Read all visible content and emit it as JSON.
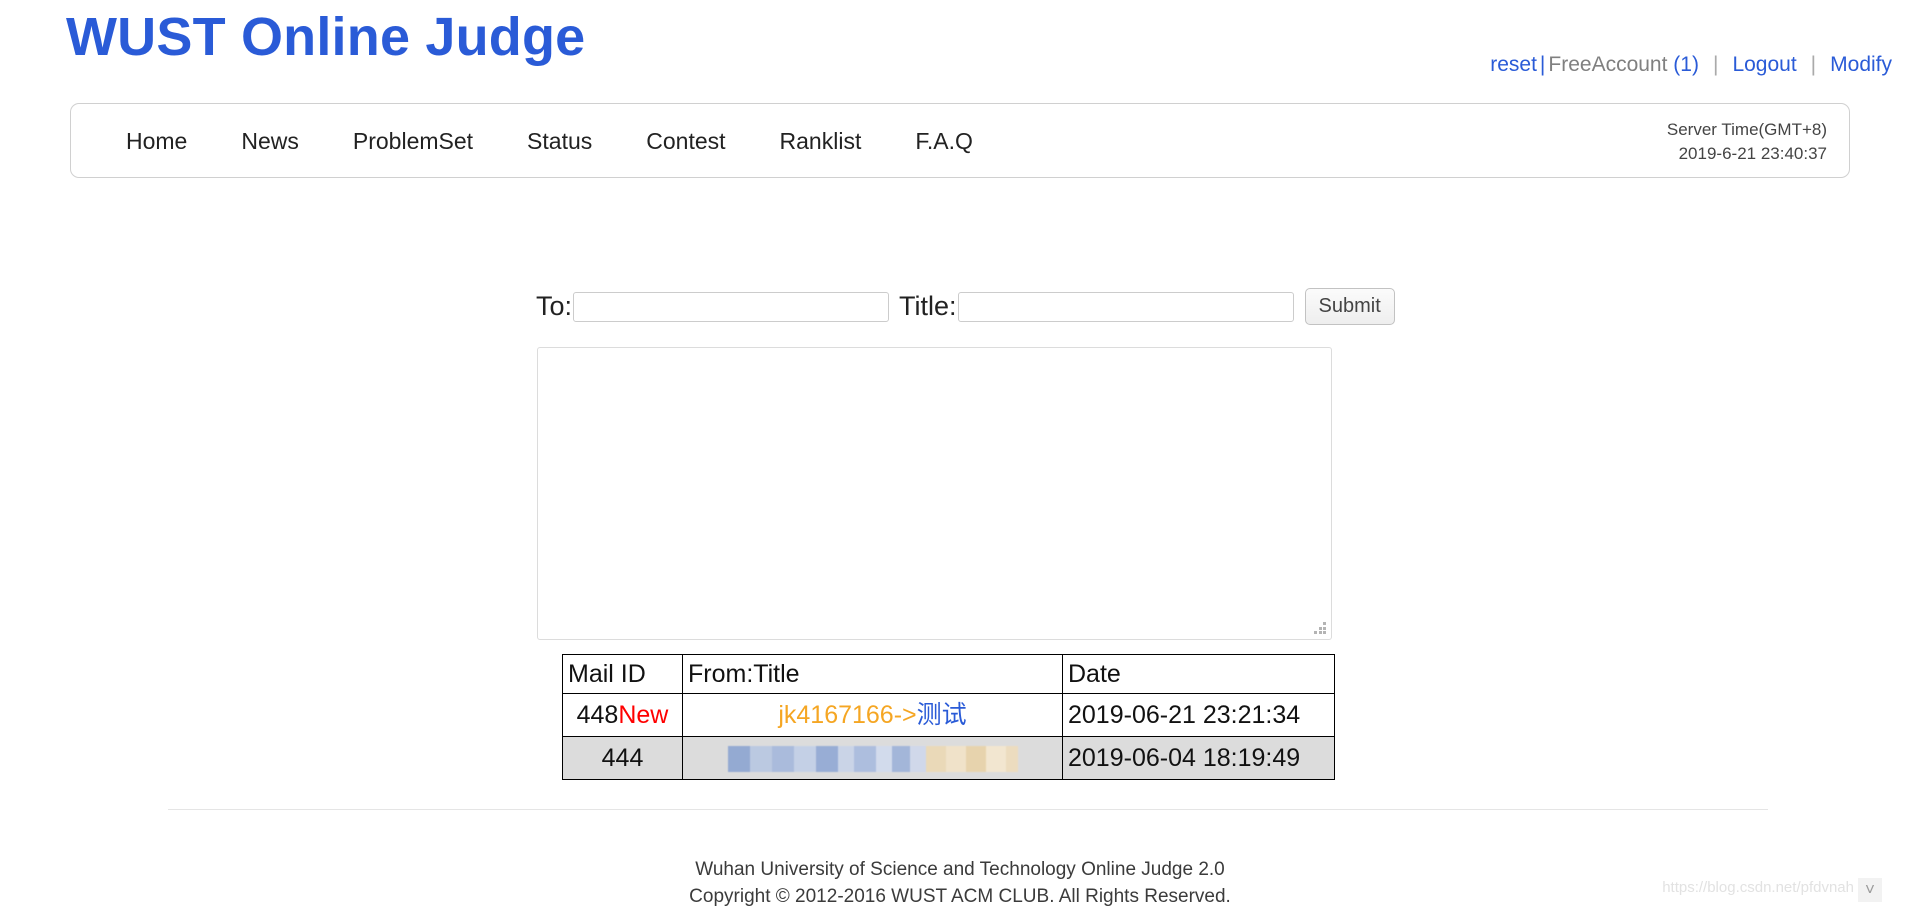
{
  "header": {
    "site_title": "WUST Online Judge",
    "account": {
      "reset_label": "reset",
      "separator": "|",
      "username": "FreeAccount",
      "newmail_count": "(1)",
      "separator2": "|",
      "logout_label": "Logout",
      "separator3": "|",
      "modify_label": "Modify"
    }
  },
  "nav": {
    "items": [
      {
        "label": "Home"
      },
      {
        "label": "News"
      },
      {
        "label": "ProblemSet"
      },
      {
        "label": "Status"
      },
      {
        "label": "Contest"
      },
      {
        "label": "Ranklist"
      },
      {
        "label": "F.A.Q"
      }
    ],
    "server_time_label": "Server Time(GMT+8)",
    "server_time_value": "2019-6-21 23:40:37"
  },
  "compose": {
    "to_label": "To:",
    "to_value": "",
    "to_placeholder": "",
    "title_label": "Title:",
    "title_value": "",
    "title_placeholder": "",
    "submit_label": "Submit",
    "body_value": "",
    "body_placeholder": ""
  },
  "mail_table": {
    "columns": [
      "Mail ID",
      "From:Title",
      "Date"
    ],
    "rows": [
      {
        "id": "448",
        "badge": "New",
        "from": "jk4167166->",
        "subject": "测试",
        "date": "2019-06-21 23:21:34",
        "redacted": false,
        "unread": true
      },
      {
        "id": "444",
        "badge": "",
        "from": "",
        "subject": "",
        "date": "2019-06-04 18:19:49",
        "redacted": true,
        "unread": false
      }
    ]
  },
  "footer": {
    "line1": "Wuhan University of Science and Technology Online Judge 2.0",
    "line2": "Copyright © 2012-2016 WUST ACM CLUB. All Rights Reserved.",
    "watermark": "https://blog.csdn.net/pfdvnah",
    "chevron": "˅"
  },
  "colors": {
    "brand_blue": "#2a5bd7",
    "link_orange": "#f5a623",
    "badge_red": "#ff0000",
    "row_alt_bg": "#dcdcdc"
  }
}
